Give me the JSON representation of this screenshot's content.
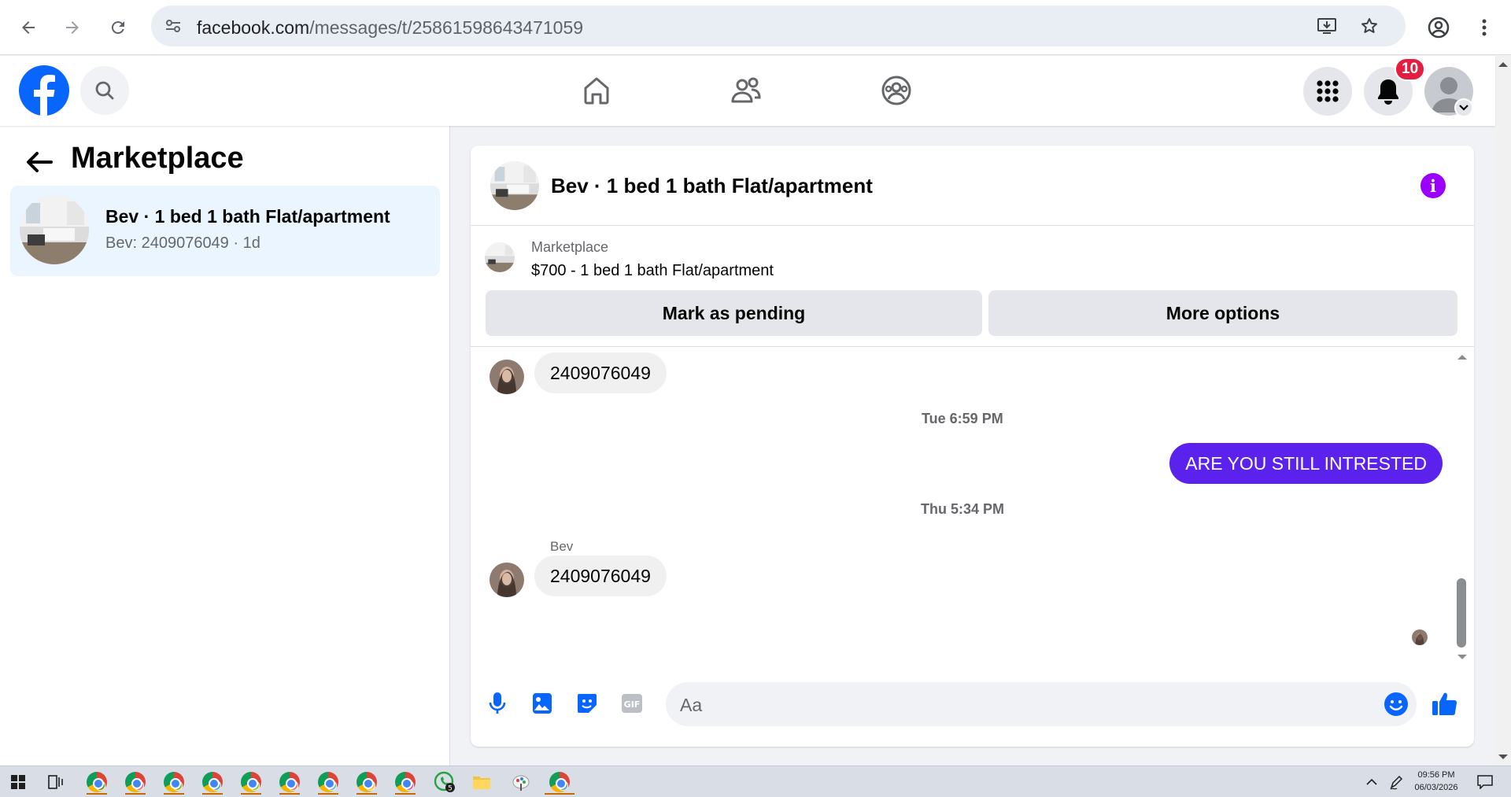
{
  "browser": {
    "url_host": "facebook.com",
    "url_path": "/messages/t/25861598643471059"
  },
  "fb_nav": {
    "notification_count": "10"
  },
  "sidebar": {
    "title": "Marketplace",
    "conversation": {
      "title": "Bev · 1 bed 1 bath Flat/apartment",
      "subtitle": "Bev: 2409076049 · 1d"
    }
  },
  "chat": {
    "title": "Bev · 1 bed 1 bath Flat/apartment",
    "marketplace": {
      "label": "Marketplace",
      "listing": "$700 - 1 bed 1 bath Flat/apartment",
      "mark_pending_label": "Mark as pending",
      "more_options_label": "More options"
    },
    "messages": {
      "first_incoming": "2409076049",
      "timestamp1": "Tue 6:59 PM",
      "outgoing": "ARE YOU STILL INTRESTED",
      "timestamp2": "Thu 5:34 PM",
      "sender_name": "Bev",
      "last_incoming": "2409076049"
    },
    "composer": {
      "placeholder": "Aa"
    }
  },
  "taskbar": {
    "time": "09:56 PM",
    "date": "06/03/2026",
    "whatsapp_badge": "5"
  },
  "colors": {
    "facebook_blue": "#0866ff",
    "outgoing_bubble": "#5b22ee",
    "info_purple": "#9b00ff",
    "notification_red": "#e41e3f",
    "selected_conversation": "#ebf5ff"
  }
}
